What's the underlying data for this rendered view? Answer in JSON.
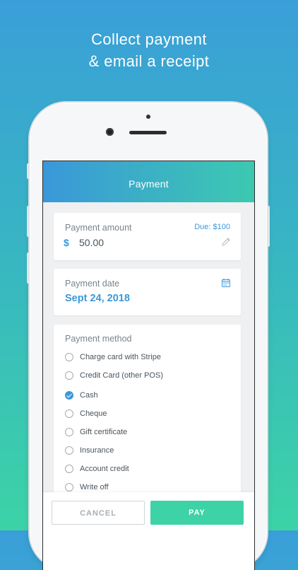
{
  "headline": {
    "line1": "Collect payment",
    "line2": "& email a receipt"
  },
  "app_bar": {
    "title": "Payment"
  },
  "payment_amount": {
    "label": "Payment amount",
    "due": "Due: $100",
    "currency": "$",
    "value": "50.00",
    "edit_icon": "pencil-icon"
  },
  "payment_date": {
    "label": "Payment date",
    "value": "Sept 24, 2018",
    "icon": "calendar-icon"
  },
  "payment_method": {
    "label": "Payment method",
    "selected": "Cash",
    "options": [
      "Charge card with Stripe",
      "Credit Card (other POS)",
      "Cash",
      "Cheque",
      "Gift certificate",
      "Insurance",
      "Account credit",
      "Write off"
    ]
  },
  "footer": {
    "cancel_label": "CANCEL",
    "pay_label": "PAY"
  },
  "colors": {
    "accent_blue": "#3a98d9",
    "accent_green": "#3dd3a7"
  }
}
